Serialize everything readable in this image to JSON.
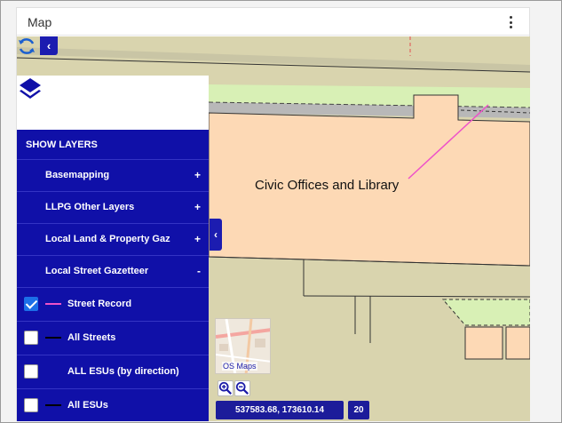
{
  "panel": {
    "title": "Map",
    "menu_icon": "kebab-menu-icon"
  },
  "map": {
    "label": "Civic Offices and Library",
    "colors": {
      "background": "#d9d4ae",
      "building": "#fdd9b5",
      "green": "#d8f0b5",
      "road": "#b8b8b8",
      "street_record": "#ee52c9"
    }
  },
  "layers": {
    "header": "SHOW LAYERS",
    "groups": [
      {
        "label": "Basemapping",
        "sign": "+"
      },
      {
        "label": "LLPG Other Layers",
        "sign": "+"
      },
      {
        "label": "Local Land & Property Gaz",
        "sign": "+"
      },
      {
        "label": "Local Street Gazetteer",
        "sign": "-"
      }
    ],
    "items": [
      {
        "label": "Street Record",
        "checked": true,
        "swatch": "#ee52c9"
      },
      {
        "label": "All Streets",
        "checked": false,
        "swatch": "#000000"
      },
      {
        "label": "ALL ESUs (by direction)",
        "checked": false,
        "swatch": ""
      },
      {
        "label": "All ESUs",
        "checked": false,
        "swatch": "#000000"
      }
    ]
  },
  "controls": {
    "basemap_thumb_label": "OS Maps",
    "coordinates": "537583.68, 173610.14",
    "zoom_level": "20"
  },
  "accent": "#1010a8"
}
